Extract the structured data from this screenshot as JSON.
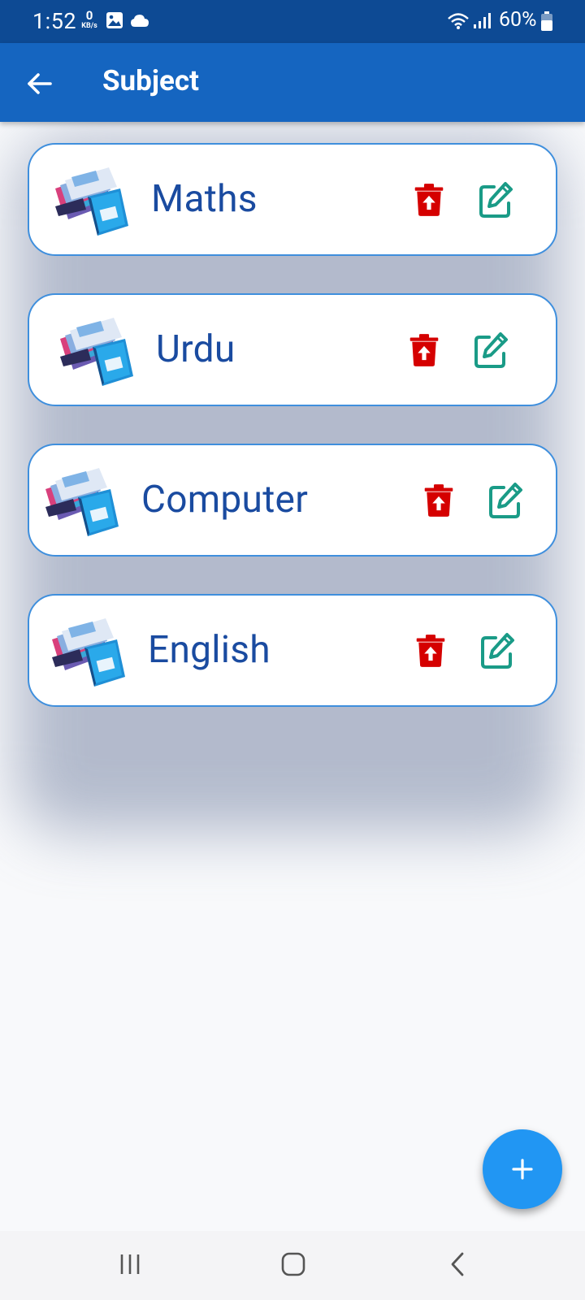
{
  "status_bar": {
    "time": "1:52",
    "net_speed_value": "0",
    "net_speed_unit": "KB/s",
    "battery": "60%",
    "icons": [
      "gallery-icon",
      "cloud-icon",
      "wifi-icon",
      "signal-icon",
      "battery-icon"
    ]
  },
  "app_bar": {
    "title": "Subject",
    "back_icon": "arrow-left-icon"
  },
  "subjects": [
    {
      "name": "Maths"
    },
    {
      "name": "Urdu"
    },
    {
      "name": "Computer"
    },
    {
      "name": "English"
    }
  ],
  "card_icons": {
    "image": "books-image",
    "delete": "delete-upload-icon",
    "edit": "edit-icon"
  },
  "fab": {
    "icon": "plus-icon"
  },
  "nav_bar": {
    "icons": [
      "recent-apps-icon",
      "home-icon",
      "back-icon"
    ]
  },
  "colors": {
    "status_bar": "#0d4a94",
    "app_bar": "#1565c0",
    "card_border": "#3f8fdd",
    "subject_text": "#1a4ba0",
    "delete_icon": "#d50000",
    "edit_icon": "#1a9b87",
    "fab": "#2196f3"
  }
}
